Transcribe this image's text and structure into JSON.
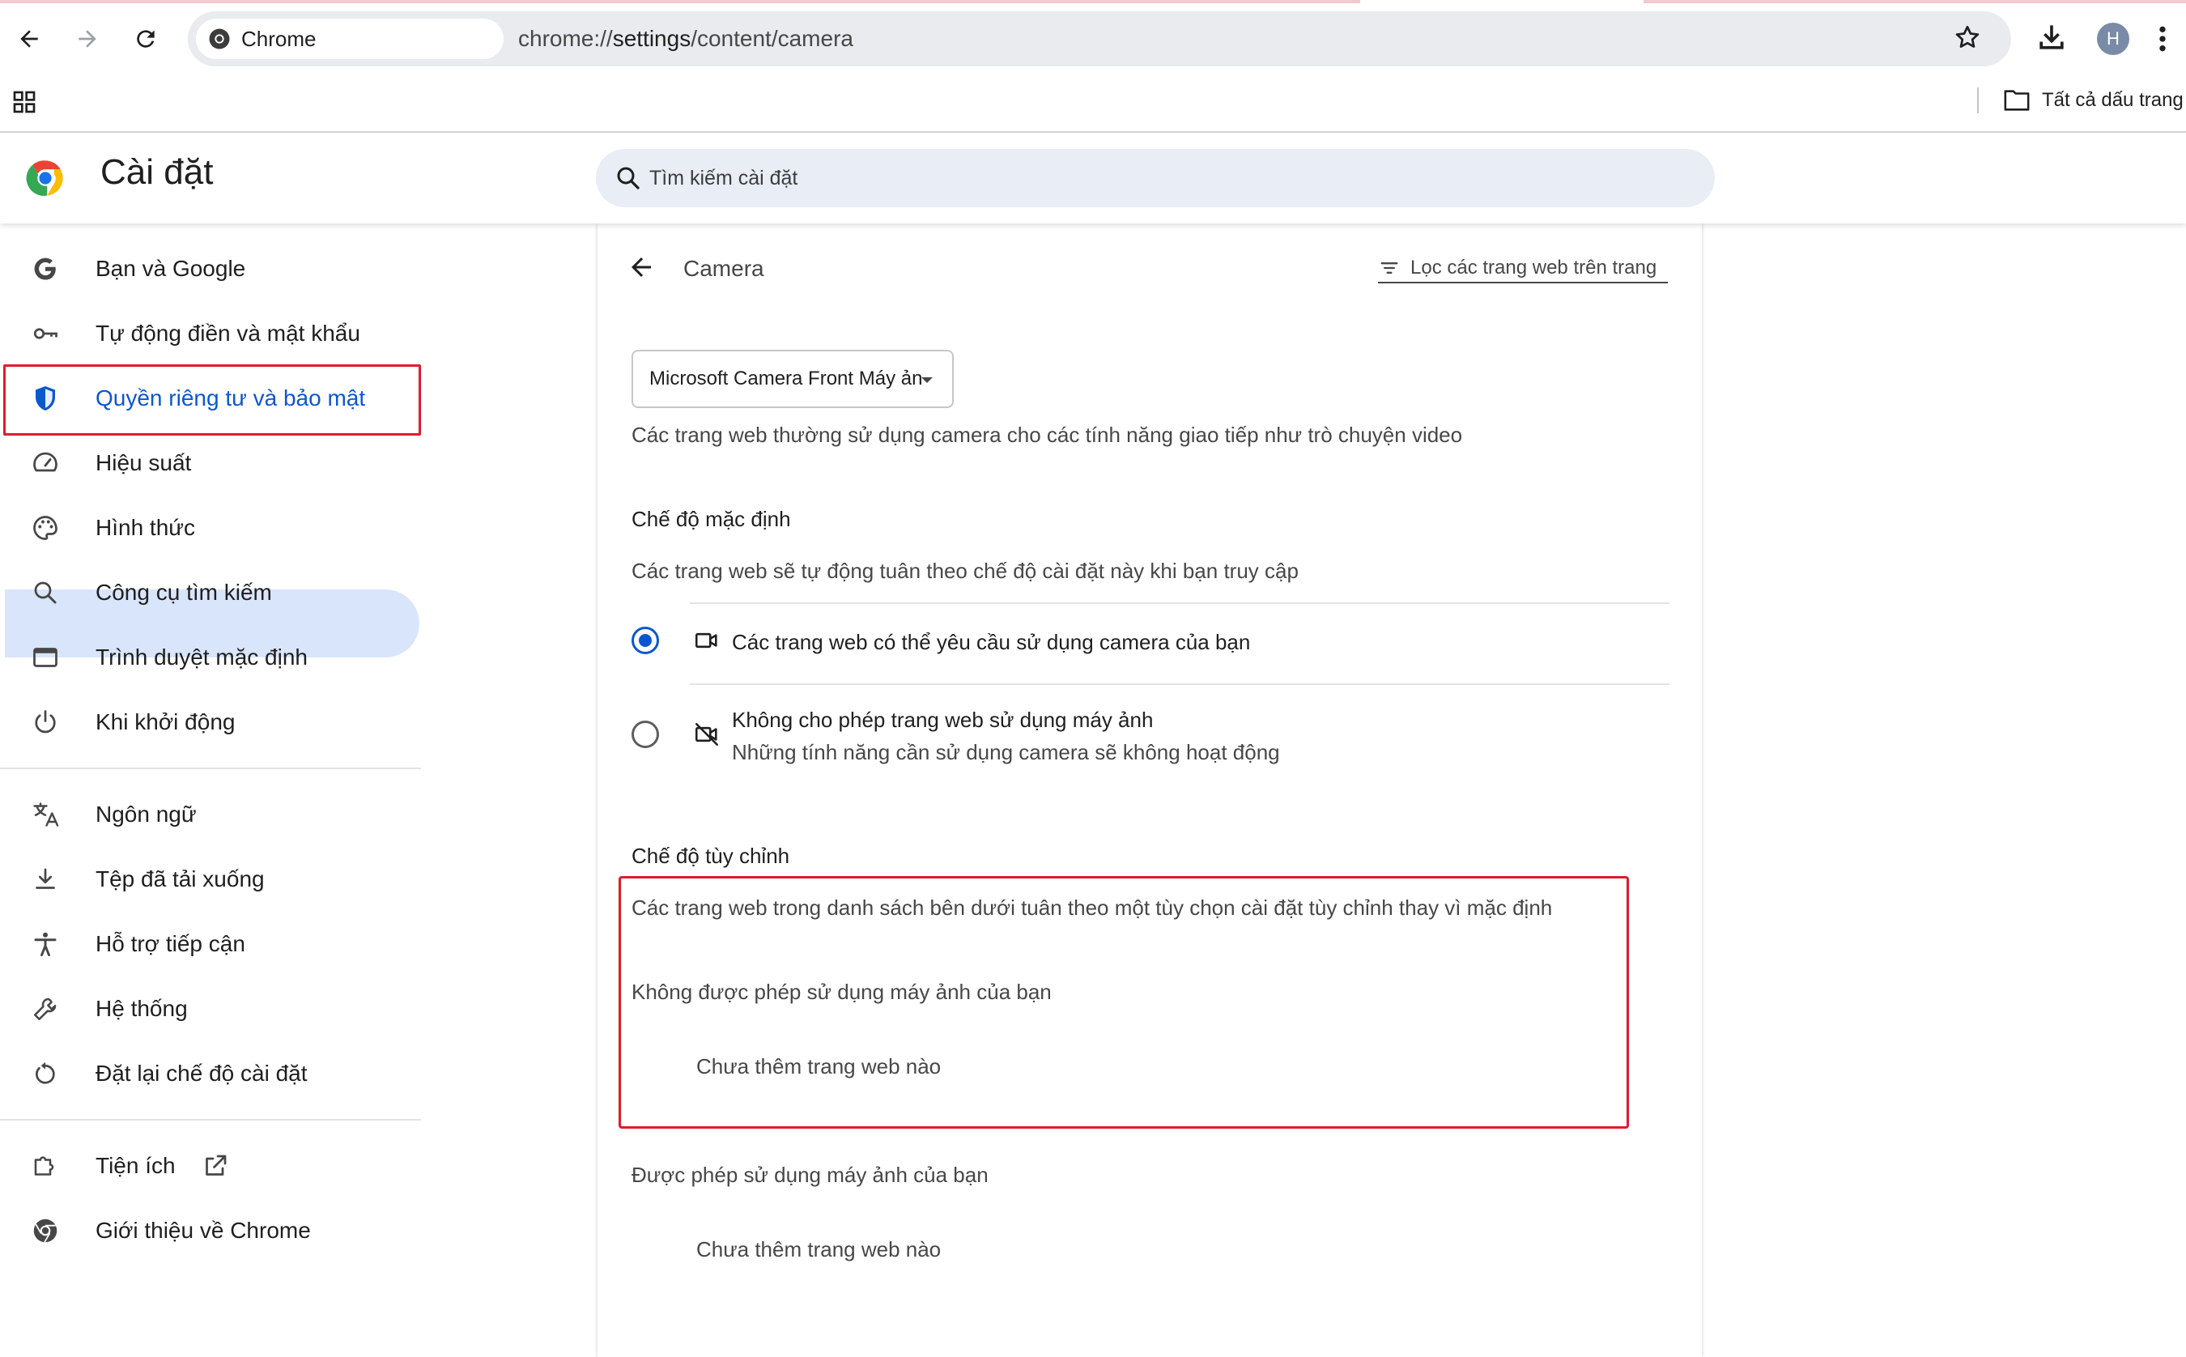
{
  "browser": {
    "chip_label": "Chrome",
    "url_scheme": "chrome://",
    "url_host": "settings",
    "url_path": "/content/camera",
    "avatar_letter": "H",
    "bookmarks_all_label": "Tất cả dấu trang"
  },
  "header": {
    "title": "Cài đặt",
    "search_placeholder": "Tìm kiếm cài đặt"
  },
  "sidebar": {
    "items": [
      {
        "label": "Bạn và Google"
      },
      {
        "label": "Tự động điền và mật khẩu"
      },
      {
        "label": "Quyền riêng tư và bảo mật"
      },
      {
        "label": "Hiệu suất"
      },
      {
        "label": "Hình thức"
      },
      {
        "label": "Công cụ tìm kiếm"
      },
      {
        "label": "Trình duyệt mặc định"
      },
      {
        "label": "Khi khởi động"
      },
      {
        "label": "Ngôn ngữ"
      },
      {
        "label": "Tệp đã tải xuống"
      },
      {
        "label": "Hỗ trợ tiếp cận"
      },
      {
        "label": "Hệ thống"
      },
      {
        "label": "Đặt lại chế độ cài đặt"
      },
      {
        "label": "Tiện ích"
      },
      {
        "label": "Giới thiệu về Chrome"
      }
    ]
  },
  "main": {
    "title": "Camera",
    "filter_label": "Lọc các trang web trên trang",
    "device_selected": "Microsoft Camera Front Máy ản",
    "intro": "Các trang web thường sử dụng camera cho các tính năng giao tiếp như trò chuyện video",
    "default_title": "Chế độ mặc định",
    "default_desc": "Các trang web sẽ tự động tuân theo chế độ cài đặt này khi bạn truy cập",
    "option_allow": "Các trang web có thể yêu cầu sử dụng camera của bạn",
    "option_block": "Không cho phép trang web sử dụng máy ảnh",
    "option_block_sub": "Những tính năng cần sử dụng camera sẽ không hoạt động",
    "custom_title": "Chế độ tùy chỉnh",
    "custom_desc": "Các trang web trong danh sách bên dưới tuân theo một tùy chọn cài đặt tùy chỉnh thay vì mặc định",
    "blocked_heading": "Không được phép sử dụng máy ảnh của bạn",
    "blocked_empty": "Chưa thêm trang web nào",
    "allowed_heading": "Được phép sử dụng máy ảnh của bạn",
    "allowed_empty": "Chưa thêm trang web nào"
  },
  "colors": {
    "accent": "#0b57d0",
    "highlight_box": "#e01b2d",
    "active_bg": "#d9e5fb"
  }
}
